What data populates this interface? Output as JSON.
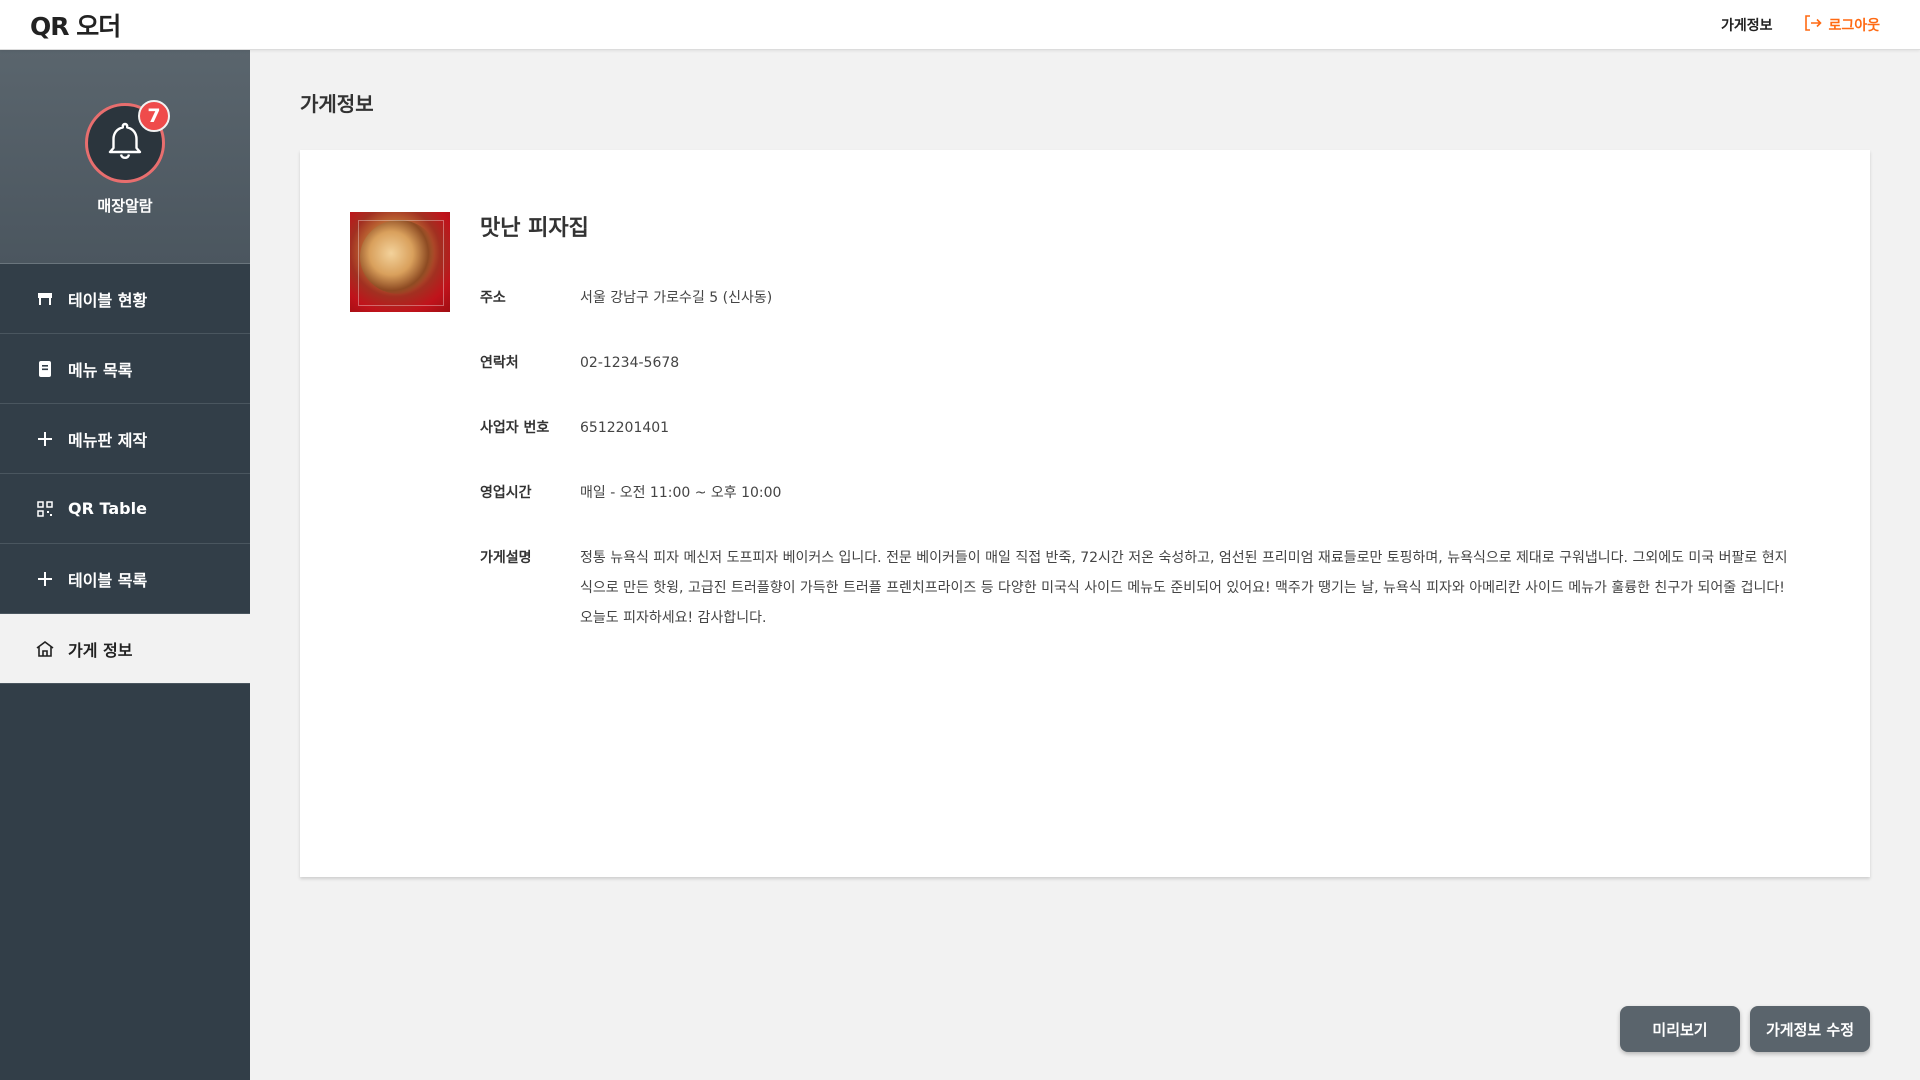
{
  "header": {
    "logo": "QR 오더",
    "store_info_link": "가게정보",
    "logout_label": "로그아웃"
  },
  "sidebar": {
    "alarm": {
      "count": "7",
      "label": "매장알람"
    },
    "items": [
      {
        "label": "테이블 현황",
        "icon": "table-icon"
      },
      {
        "label": "메뉴 목록",
        "icon": "menu-book-icon"
      },
      {
        "label": "메뉴판 제작",
        "icon": "plus-icon"
      },
      {
        "label": "QR Table",
        "icon": "qr-code-icon"
      },
      {
        "label": "테이블 목록",
        "icon": "plus-icon"
      },
      {
        "label": "가게 정보",
        "icon": "store-icon",
        "active": true
      }
    ]
  },
  "main": {
    "page_title": "가게정보",
    "store": {
      "name": "맛난 피자집",
      "fields": [
        {
          "label": "주소",
          "value": "서울 강남구 가로수길 5 (신사동)"
        },
        {
          "label": "연락처",
          "value": "02-1234-5678"
        },
        {
          "label": "사업자 번호",
          "value": "6512201401"
        },
        {
          "label": "영업시간",
          "value": "매일 - 오전 11:00 ~ 오후 10:00"
        },
        {
          "label": "가게설명",
          "value": "정통 뉴욕식 피자 메신저 도프피자 베이커스 입니다. 전문 베이커들이 매일 직접 반죽, 72시간 저온 숙성하고, 엄선된 프리미엄 재료들로만 토핑하며, 뉴욕식으로 제대로 구워냅니다. 그외에도 미국 버팔로 현지식으로 만든 핫윙, 고급진 트러플향이 가득한 트러플 프렌치프라이즈 등 다양한 미국식 사이드 메뉴도 준비되어 있어요! 맥주가 땡기는 날, 뉴욕식 피자와 아메리칸 사이드 메뉴가 훌륭한 친구가 되어줄 겁니다! 오늘도 피자하세요! 감사합니다."
        }
      ]
    },
    "buttons": {
      "preview": "미리보기",
      "edit": "가게정보 수정"
    }
  },
  "colors": {
    "accent": "#ff6a13",
    "sidebar": "#323e48",
    "badge": "#ef4b4b",
    "button": "#5a646c"
  }
}
